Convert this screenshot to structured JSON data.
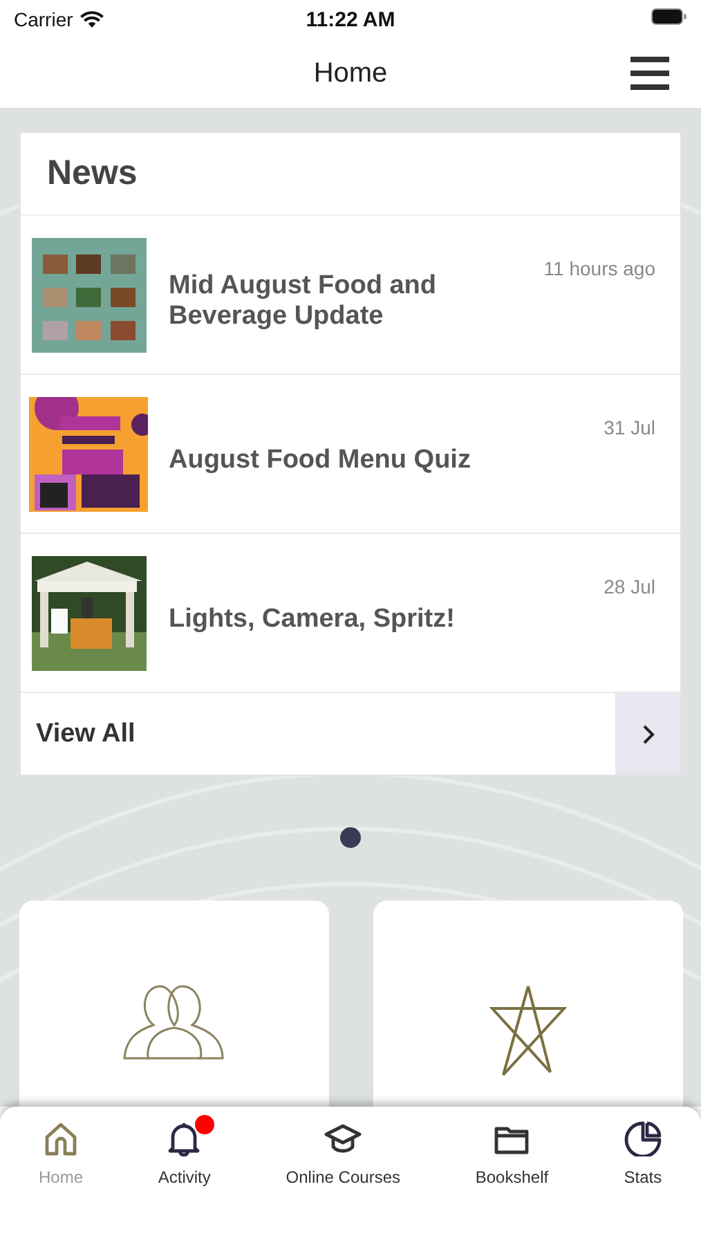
{
  "status_bar": {
    "carrier": "Carrier",
    "time": "11:22 AM"
  },
  "nav": {
    "title": "Home"
  },
  "news": {
    "heading": "News",
    "items": [
      {
        "title": "Mid August Food and Beverage Update",
        "time": "11 hours ago"
      },
      {
        "title": "August Food Menu Quiz",
        "time": "31 Jul"
      },
      {
        "title": "Lights, Camera, Spritz!",
        "time": "28 Jul"
      }
    ],
    "view_all": "View All"
  },
  "pager": [
    {
      "selected": true
    }
  ],
  "tab_bar": [
    {
      "label": "Home",
      "selected": true,
      "badge": false
    },
    {
      "label": "Activity",
      "selected": false,
      "badge": true
    },
    {
      "label": "Online Courses",
      "selected": false,
      "badge": false
    },
    {
      "label": "Bookshelf",
      "selected": false,
      "badge": false
    },
    {
      "label": "Stats",
      "selected": false,
      "badge": false
    }
  ]
}
